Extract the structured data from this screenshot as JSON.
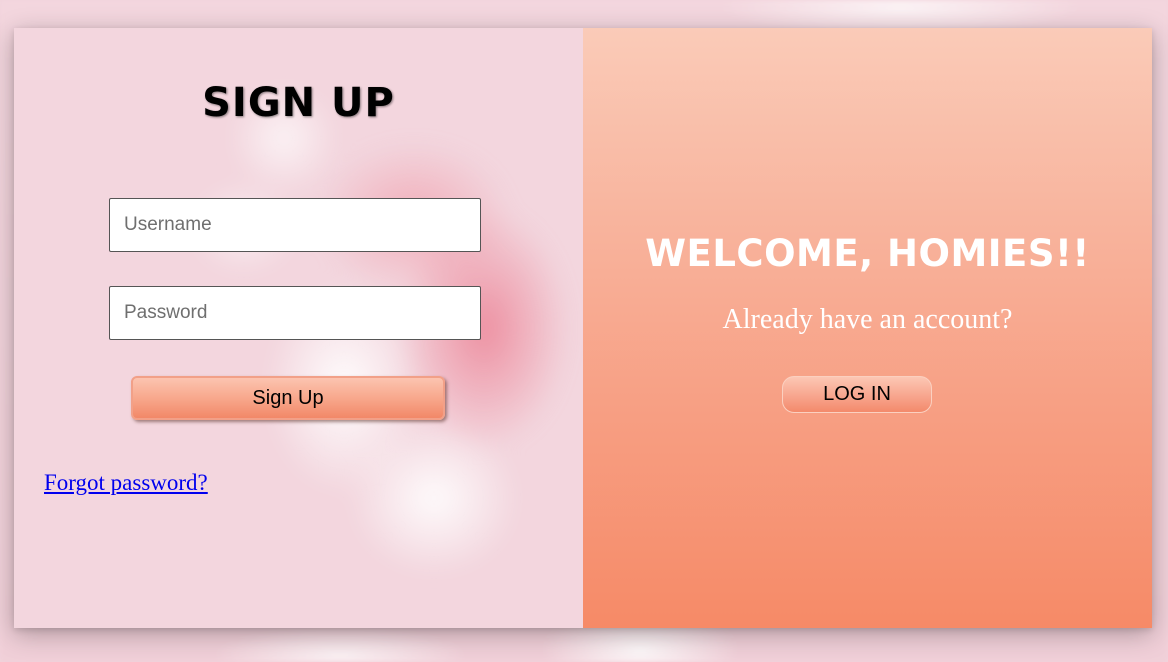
{
  "signup_panel": {
    "title": "SIGN UP",
    "username_placeholder": "Username",
    "password_placeholder": "Password",
    "signup_button_label": "Sign Up",
    "forgot_password_link": "Forgot password?"
  },
  "login_panel": {
    "heading": "WELCOME, HOMIES!!",
    "prompt": "Already have an account?",
    "login_button_label": "LOG IN"
  },
  "colors": {
    "page_background": "#f2d4dc",
    "signup_button": "#f7a589",
    "login_panel_top": "#facbb8",
    "login_panel_bottom": "#f68a67",
    "link": "#0000ee"
  }
}
